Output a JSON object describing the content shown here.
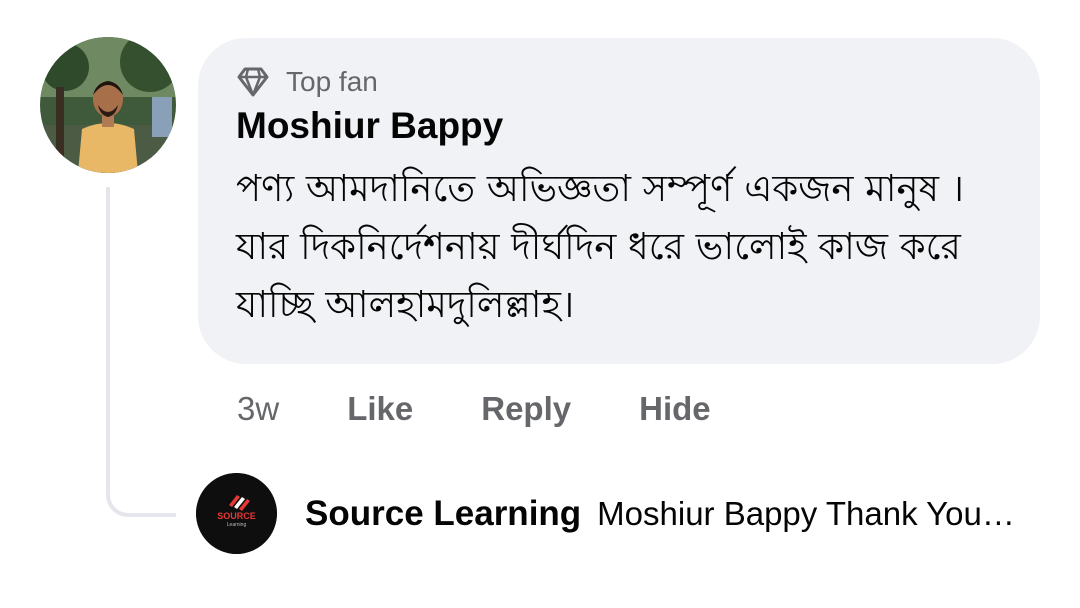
{
  "comment": {
    "badge_label": "Top fan",
    "badge_icon": "diamond-icon",
    "author": "Moshiur Bappy",
    "text": "পণ্য আমদানিতে অভিজ্ঞতা সম্পূর্ণ একজন মানুষ । যার দিকনির্দেশনায় দীর্ঘদিন ধরে ভালোই কাজ করে যাচ্ছি আলহামদুলিল্লাহ।",
    "avatar_icon": "user-avatar"
  },
  "actions": {
    "time": "3w",
    "like": "Like",
    "reply": "Reply",
    "hide": "Hide"
  },
  "reply": {
    "author": "Source Learning",
    "text": "Moshiur Bappy Thank You…",
    "avatar_logo_text": "SOURCE",
    "avatar_logo_subtext": "Learning",
    "avatar_icon": "source-learning-logo"
  },
  "colors": {
    "bubble_bg": "#f0f2f5",
    "secondary_text": "#65676b",
    "primary_text": "#050505",
    "thread_line": "#e4e6eb",
    "logo_red": "#e53935"
  }
}
